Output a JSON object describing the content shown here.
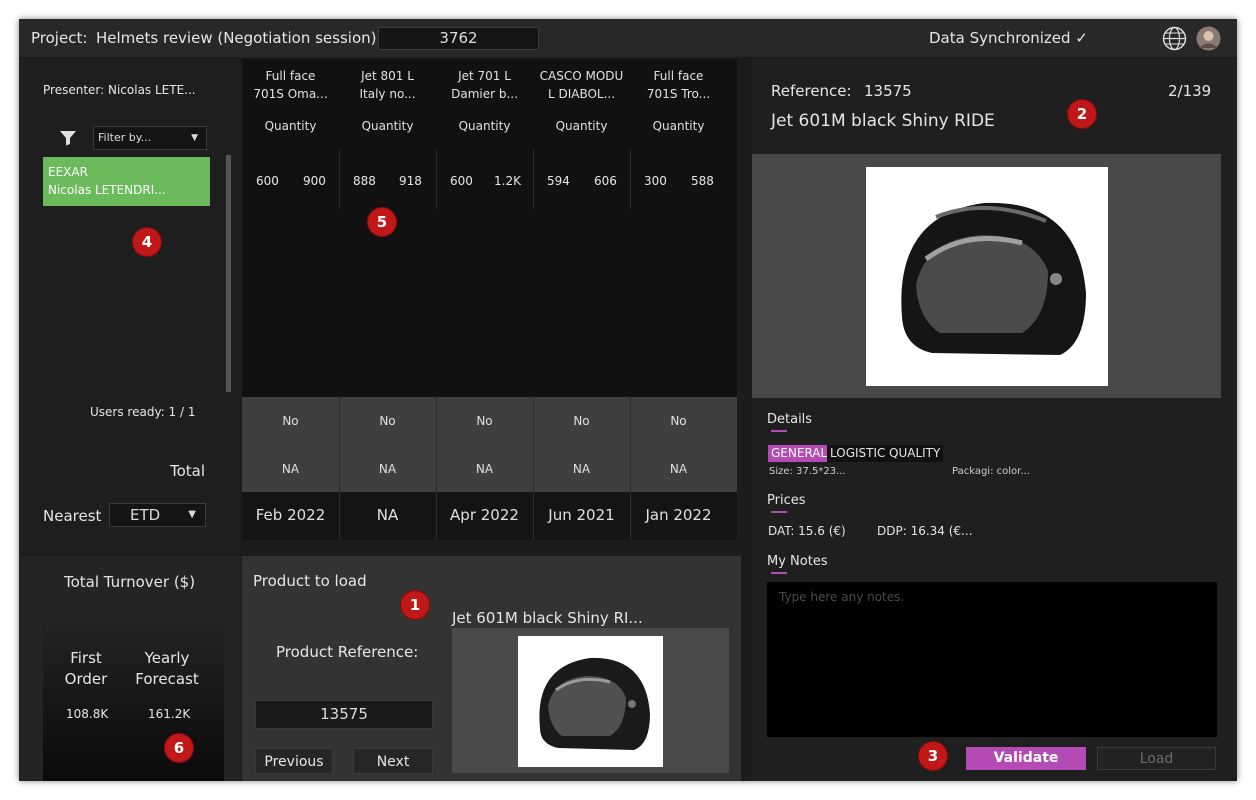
{
  "topbar": {
    "project_label": "Project:",
    "project_name": "Helmets review (Negotiation session)",
    "project_code": "3762",
    "sync_status": "Data Synchronized ✓"
  },
  "left_panel": {
    "presenter": "Presenter: Nicolas LETE...",
    "filter_placeholder": "Filter by...",
    "selected_item_line1": "EEXAR",
    "selected_item_line2": "Nicolas LETENDRI...",
    "users_ready": "Users ready:  1  /  1",
    "total_label": "Total",
    "nearest_label": "Nearest",
    "nearest_value": "ETD"
  },
  "grid": {
    "columns": [
      {
        "line1": "Full face",
        "line2": "701S Oma...",
        "sub": "Quantity",
        "v1": "600",
        "v2": "900",
        "row1": "No",
        "row2": "NA",
        "date": "Feb 2022"
      },
      {
        "line1": "Jet 801 L",
        "line2": "Italy no...",
        "sub": "Quantity",
        "v1": "888",
        "v2": "918",
        "row1": "No",
        "row2": "NA",
        "date": "NA"
      },
      {
        "line1": "Jet 701 L",
        "line2": "Damier b...",
        "sub": "Quantity",
        "v1": "600",
        "v2": "1.2K",
        "row1": "No",
        "row2": "NA",
        "date": "Apr 2022"
      },
      {
        "line1": "CASCO MODU",
        "line2": "L DIABOL...",
        "sub": "Quantity",
        "v1": "594",
        "v2": "606",
        "row1": "No",
        "row2": "NA",
        "date": "Jun 2021"
      },
      {
        "line1": "Full face",
        "line2": "701S Tro...",
        "sub": "Quantity",
        "v1": "300",
        "v2": "588",
        "row1": "No",
        "row2": "NA",
        "date": "Jan 2022"
      }
    ]
  },
  "turnover": {
    "title": "Total Turnover ($)",
    "first_order_label_1": "First",
    "first_order_label_2": "Order",
    "yearly_label_1": "Yearly",
    "yearly_label_2": "Forecast",
    "first_order_value": "108.8K",
    "yearly_value": "161.2K"
  },
  "product_load": {
    "title": "Product to load",
    "reference_label": "Product Reference:",
    "reference_value": "13575",
    "preview_name": "Jet 601M black Shiny RI...",
    "previous_label": "Previous",
    "next_label": "Next"
  },
  "detail": {
    "reference_label": "Reference:",
    "reference_value": "13575",
    "position": "2/139",
    "product_name": "Jet 601M black Shiny RIDE",
    "details_heading": "Details",
    "tabs": [
      "GENERAL",
      "LOGISTIC",
      "QUALITY"
    ],
    "size_text": "Size:  37.5*23...",
    "packaging_text": "Packagi:  color...",
    "prices_heading": "Prices",
    "dat_text": "DAT:  15.6 (€)",
    "ddp_text": "DDP:  16.34 (€...",
    "notes_heading": "My Notes",
    "notes_placeholder": "Type here any notes.",
    "validate_label": "Validate",
    "load_label": "Load"
  },
  "badges": [
    "1",
    "2",
    "3",
    "4",
    "5",
    "6"
  ],
  "icons": [
    "filter-icon",
    "dropdown-arrow-icon",
    "globe-icon",
    "avatar",
    "helmet-image"
  ],
  "colors": {
    "accent": "#b44ab4",
    "selected": "#6bbb5c",
    "badge": "#c01818"
  }
}
